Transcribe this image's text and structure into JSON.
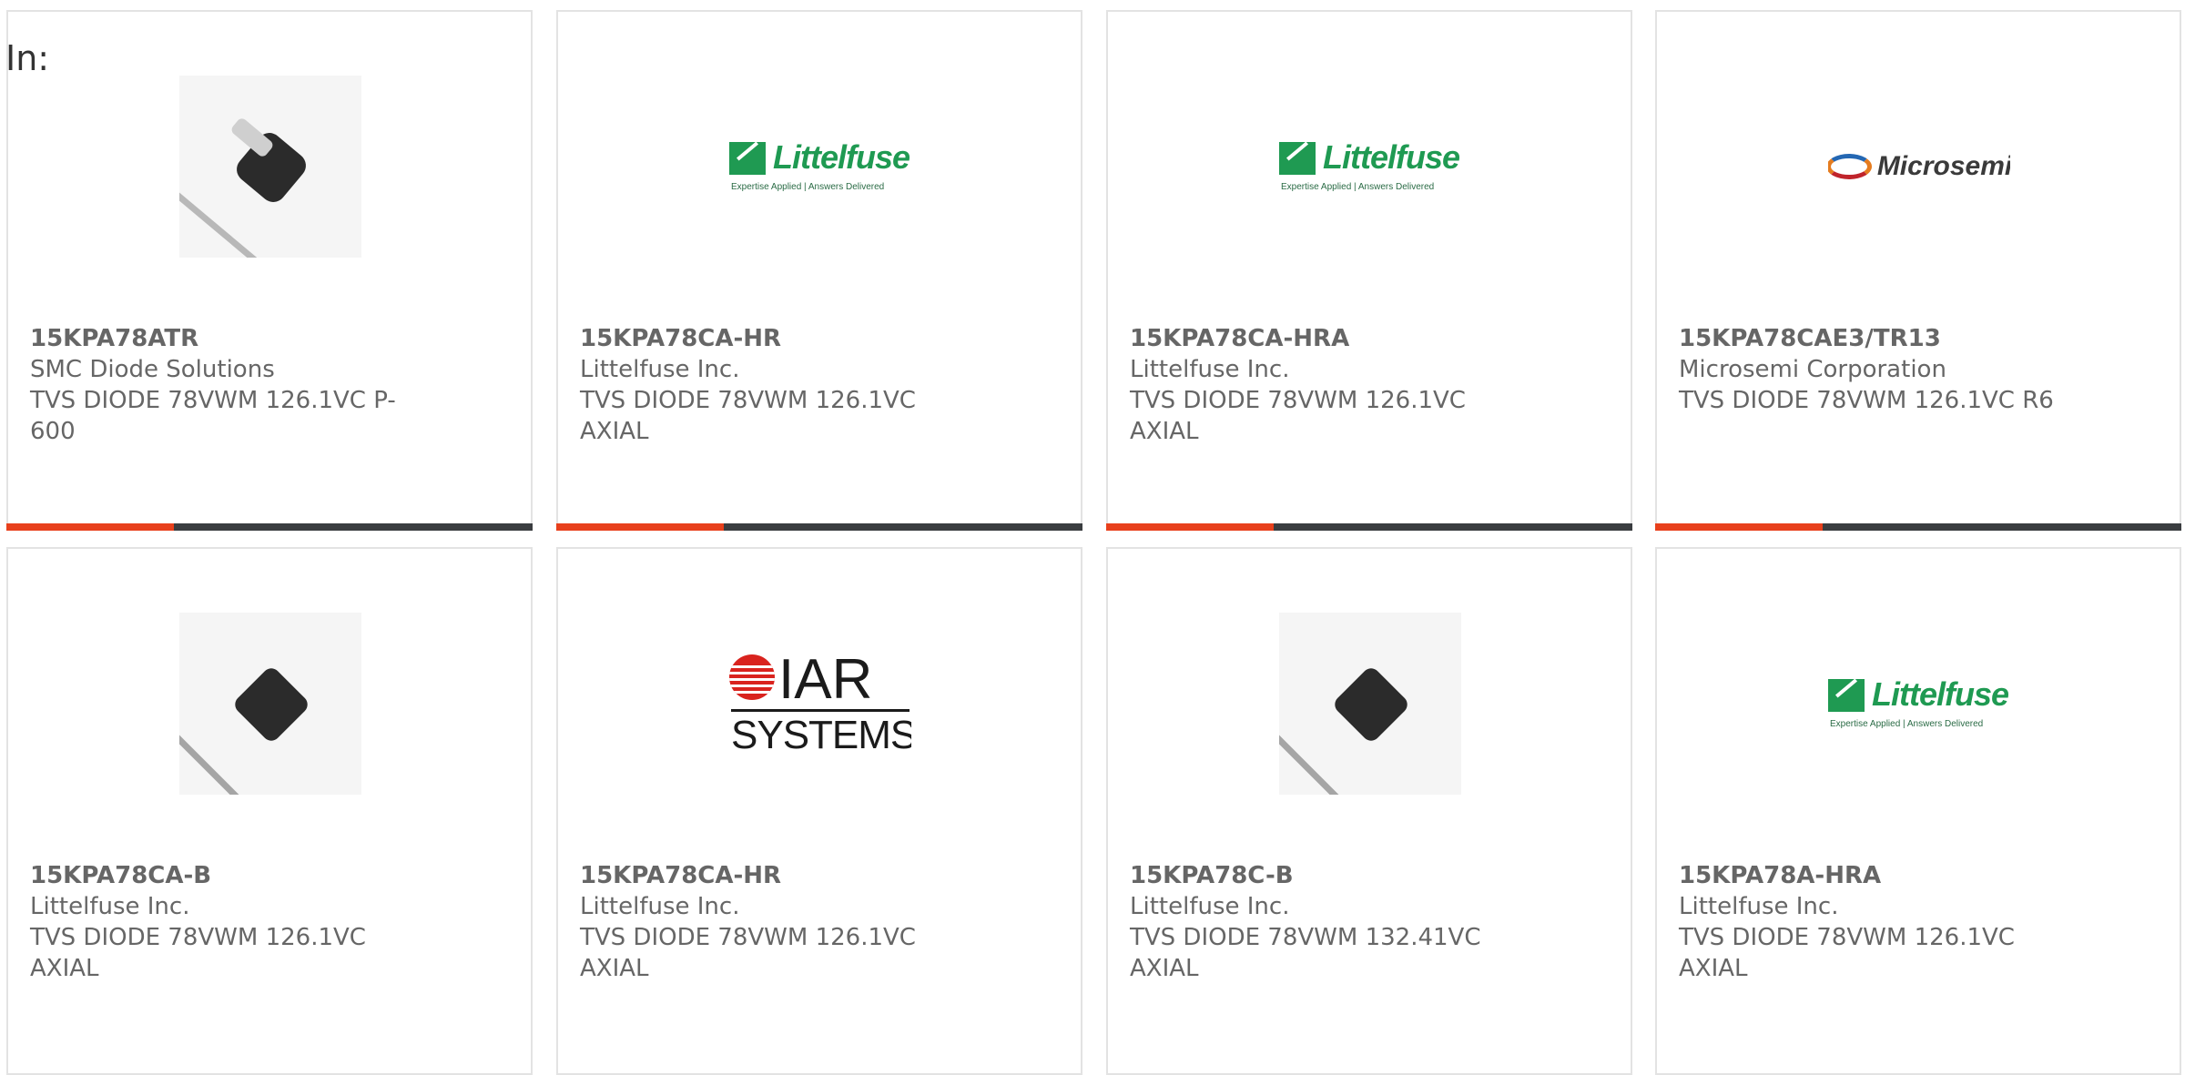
{
  "in_label": "In:",
  "colors": {
    "accent": "#e8401c",
    "bar_dark": "#3a3d40",
    "card_border": "#e3e3e3",
    "text": "#666666",
    "littelfuse_green": "#1f9a52"
  },
  "products": [
    {
      "part_number": "15KPA78ATR",
      "manufacturer": "SMC Diode Solutions",
      "desc1": "TVS DIODE 78VWM 126.1VC P-",
      "desc2": "600",
      "image": "diode-axial-banded-photo"
    },
    {
      "part_number": "15KPA78CA-HR",
      "manufacturer": "Littelfuse Inc.",
      "desc1": "TVS DIODE 78VWM 126.1VC",
      "desc2": "AXIAL",
      "image": "littelfuse-logo"
    },
    {
      "part_number": "15KPA78CA-HRA",
      "manufacturer": "Littelfuse Inc.",
      "desc1": "TVS DIODE 78VWM 126.1VC",
      "desc2": "AXIAL",
      "image": "littelfuse-logo"
    },
    {
      "part_number": "15KPA78CAE3/TR13",
      "manufacturer": "Microsemi Corporation",
      "desc1": "TVS DIODE 78VWM 126.1VC R6",
      "desc2": "",
      "image": "microsemi-logo"
    },
    {
      "part_number": "15KPA78CA-B",
      "manufacturer": "Littelfuse Inc.",
      "desc1": "TVS DIODE 78VWM 126.1VC",
      "desc2": "AXIAL",
      "image": "diode-axial-photo"
    },
    {
      "part_number": "15KPA78CA-HR",
      "manufacturer": "Littelfuse Inc.",
      "desc1": "TVS DIODE 78VWM 126.1VC",
      "desc2": "AXIAL",
      "image": "iar-systems-logo"
    },
    {
      "part_number": "15KPA78C-B",
      "manufacturer": "Littelfuse Inc.",
      "desc1": "TVS DIODE 78VWM 132.41VC",
      "desc2": "AXIAL",
      "image": "diode-axial-photo"
    },
    {
      "part_number": "15KPA78A-HRA",
      "manufacturer": "Littelfuse Inc.",
      "desc1": "TVS DIODE 78VWM 126.1VC",
      "desc2": "AXIAL",
      "image": "littelfuse-logo"
    }
  ],
  "logos": {
    "littelfuse_word": "Littelfuse",
    "littelfuse_tagline": "Expertise Applied | Answers Delivered",
    "microsemi_word": "Microsemi",
    "iar_word1": "IAR",
    "iar_word2": "SYSTEMS"
  }
}
